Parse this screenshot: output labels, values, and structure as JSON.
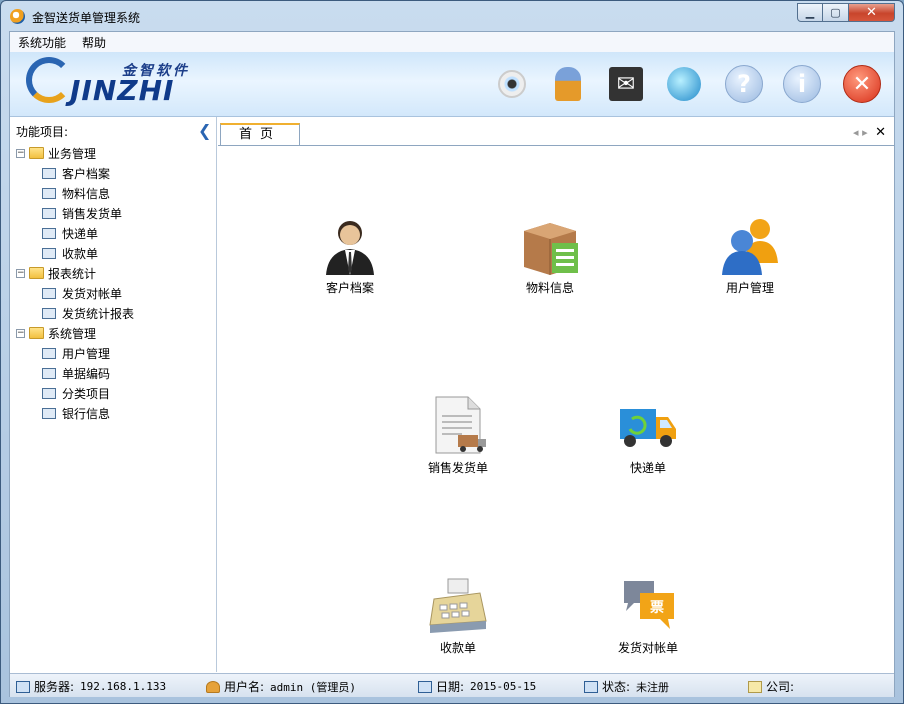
{
  "window": {
    "title": "金智送货单管理系统"
  },
  "menu": [
    "系统功能",
    "帮助"
  ],
  "logo": {
    "cn": "金智软件",
    "en": "JINZHI"
  },
  "toolbar": {
    "icons": [
      "camera-icon",
      "user-icon",
      "mail-icon",
      "network-icon",
      "help-icon",
      "info-icon",
      "exit-icon"
    ],
    "help_glyph": "?",
    "info_glyph": "i",
    "exit_glyph": "✕"
  },
  "left_panel": {
    "title": "功能项目:",
    "groups": [
      {
        "label": "业务管理",
        "items": [
          "客户档案",
          "物料信息",
          "销售发货单",
          "快递单",
          "收款单"
        ]
      },
      {
        "label": "报表统计",
        "items": [
          "发货对帐单",
          "发货统计报表"
        ]
      },
      {
        "label": "系统管理",
        "items": [
          "用户管理",
          "单据编码",
          "分类项目",
          "银行信息"
        ]
      }
    ]
  },
  "tab": {
    "label": "首页"
  },
  "tiles": [
    {
      "label": "客户档案"
    },
    {
      "label": "物料信息"
    },
    {
      "label": "用户管理"
    },
    {
      "label": "销售发货单"
    },
    {
      "label": "快递单"
    },
    {
      "label": "收款单"
    },
    {
      "label": "发货对帐单"
    }
  ],
  "status": {
    "server_label": "服务器:",
    "server_value": "192.168.1.133",
    "user_label": "用户名:",
    "user_value": "admin (管理员)",
    "date_label": "日期:",
    "date_value": "2015-05-15",
    "state_label": "状态:",
    "state_value": "未注册",
    "company_label": "公司:",
    "company_value": ""
  },
  "colors": {
    "accent": "#2a65b2",
    "tab_highlight": "#f0b030",
    "exit_red": "#d8301a"
  }
}
